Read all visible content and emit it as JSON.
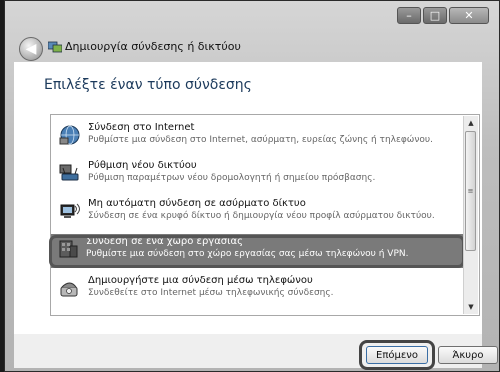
{
  "window": {
    "title": "Δημιουργία σύνδεσης ή δικτύου",
    "controls": {
      "minimize": "–",
      "maximize": "□",
      "close": "✕"
    }
  },
  "back_button_glyph": "◀",
  "heading": "Επιλέξτε έναν τύπο σύνδεσης",
  "options": [
    {
      "title": "Σύνδεση στο Internet",
      "desc": "Ρυθμίστε μια σύνδεση στο Internet, ασύρματη, ευρείας ζώνης ή τηλεφώνου.",
      "icon": "globe-network-icon"
    },
    {
      "title": "Ρύθμιση νέου δικτύου",
      "desc": "Ρύθμιση παραμέτρων νέου δρομολογητή ή σημείου πρόσβασης.",
      "icon": "router-network-icon"
    },
    {
      "title": "Μη αυτόματη σύνδεση σε ασύρματο δίκτυο",
      "desc": "Σύνδεση σε ένα κρυφό δίκτυο ή δημιουργία νέου προφίλ ασύρματου δικτύου.",
      "icon": "wireless-computer-icon"
    },
    {
      "title": "Σύνδεση σε ένα χώρο εργασίας",
      "desc": "Ρυθμίστε μια σύνδεση στο χώρο εργασίας σας μέσω τηλεφώνου ή VPN.",
      "icon": "workplace-building-icon",
      "selected": true
    },
    {
      "title": "Δημιουργήστε μια σύνδεση μέσω τηλεφώνου",
      "desc": "Συνδεθείτε στο Internet μέσω τηλεφωνικής σύνδεσης.",
      "icon": "dialup-phone-icon"
    }
  ],
  "scrollbar": {
    "up": "▲",
    "down": "▼",
    "grip": "≡"
  },
  "buttons": {
    "next": "Επόμενο",
    "cancel": "Άκυρο"
  }
}
